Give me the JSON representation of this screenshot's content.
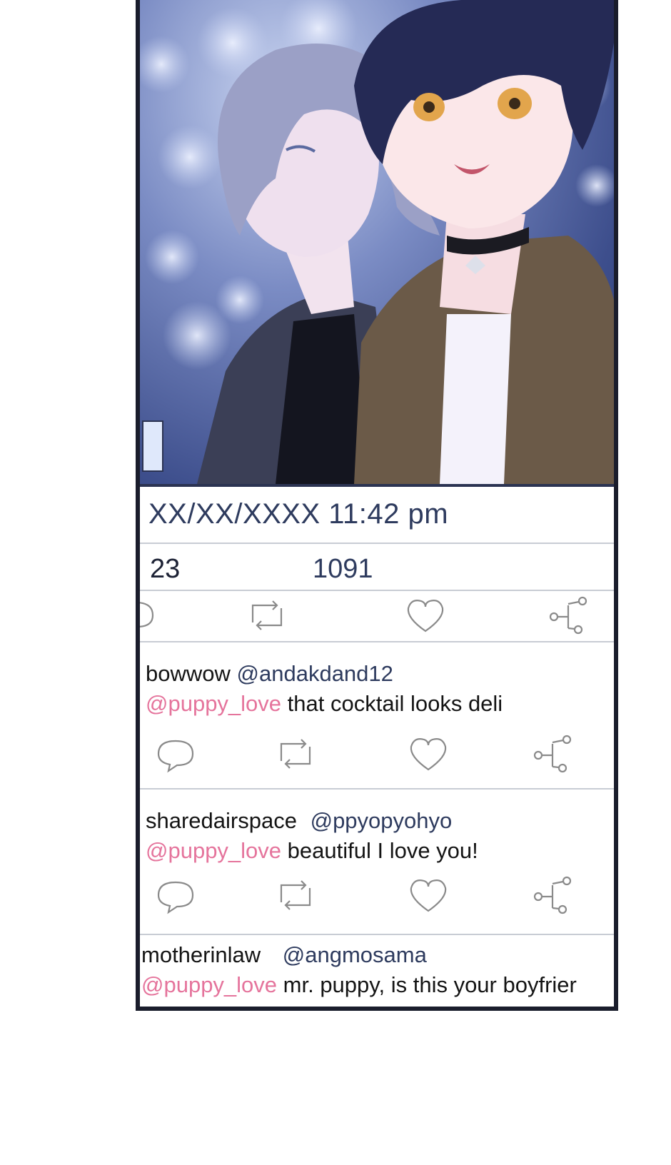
{
  "post": {
    "timestamp": "XX/XX/XXXX 11:42 pm",
    "replies_count": "23",
    "likes_count": "1091"
  },
  "action_icons": [
    "reply-icon",
    "retweet-icon",
    "heart-icon",
    "share-icon"
  ],
  "comments": [
    {
      "username": "bowwow",
      "handle": "@andakdand12",
      "mention": "@puppy_love",
      "text": " that cocktail looks deli"
    },
    {
      "username": "sharedairspace",
      "handle": "@ppyopyohyo",
      "mention": "@puppy_love",
      "text": " beautiful I love you!"
    },
    {
      "username": "motherinlaw",
      "handle": "@angmosama",
      "mention": "@puppy_love",
      "text": " mr. puppy, is this your boyfrier"
    }
  ],
  "colors": {
    "mention": "#e5749c",
    "handle": "#2e3b5e",
    "divider": "#c8ccd4",
    "frame": "#1a1d2c"
  }
}
